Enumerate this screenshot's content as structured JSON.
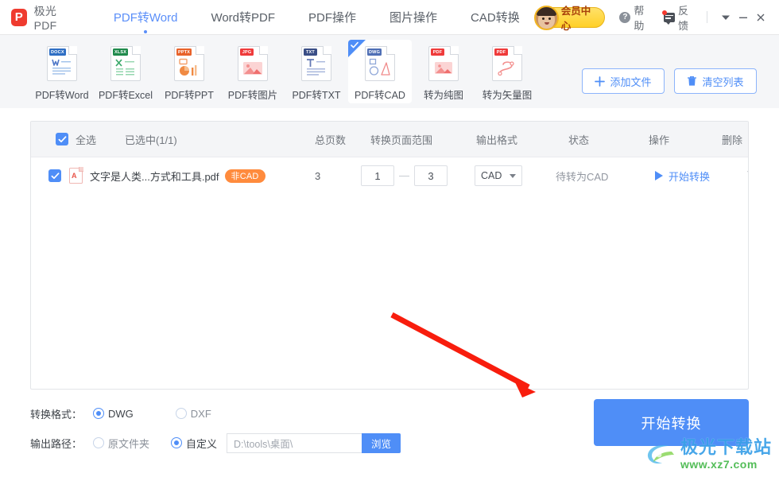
{
  "app": {
    "logo_letter": "P",
    "logo_text": "极光PDF"
  },
  "nav": {
    "items": [
      {
        "label": "PDF转Word",
        "active": true
      },
      {
        "label": "Word转PDF",
        "active": false
      },
      {
        "label": "PDF操作",
        "active": false
      },
      {
        "label": "图片操作",
        "active": false
      },
      {
        "label": "CAD转换",
        "active": false
      }
    ]
  },
  "titlebar": {
    "vip_label": "会员中心",
    "help_label": "帮助",
    "help_glyph": "?",
    "feedback_label": "反馈",
    "dropdown_icon": "chevron-down-icon",
    "minimize_icon": "minimize-icon",
    "close_icon": "close-icon"
  },
  "toolstrip": {
    "tools": [
      {
        "label": "PDF转Word",
        "badge": "DOCX",
        "badge_color": "#2f6fc4",
        "selected": false,
        "icon": "word-doc-icon"
      },
      {
        "label": "PDF转Excel",
        "badge": "XLSX",
        "badge_color": "#1f8a4c",
        "selected": false,
        "icon": "excel-doc-icon"
      },
      {
        "label": "PDF转PPT",
        "badge": "PPTX",
        "badge_color": "#e8622a",
        "selected": false,
        "icon": "ppt-doc-icon"
      },
      {
        "label": "PDF转图片",
        "badge": "JPG",
        "badge_color": "#ef3b3b",
        "selected": false,
        "icon": "image-doc-icon"
      },
      {
        "label": "PDF转TXT",
        "badge": "TXT",
        "badge_color": "#3a4e86",
        "selected": false,
        "icon": "txt-doc-icon"
      },
      {
        "label": "PDF转CAD",
        "badge": "DWG",
        "badge_color": "#4f6fb5",
        "selected": true,
        "icon": "cad-doc-icon"
      },
      {
        "label": "转为纯图",
        "badge": "PDF",
        "badge_color": "#ef3b3b",
        "selected": false,
        "icon": "raster-doc-icon"
      },
      {
        "label": "转为矢量图",
        "badge": "PDF",
        "badge_color": "#ef3b3b",
        "selected": false,
        "icon": "vector-doc-icon"
      }
    ],
    "add_file_label": "添加文件",
    "clear_list_label": "清空列表"
  },
  "table": {
    "headers": {
      "select_all": "全选",
      "selected_count": "已选中(1/1)",
      "total_pages": "总页数",
      "page_range": "转换页面范围",
      "output_format": "输出格式",
      "status": "状态",
      "operation": "操作",
      "delete": "删除"
    },
    "rows": [
      {
        "checked": true,
        "filename": "文字是人类...方式和工具.pdf",
        "tag": "非CAD",
        "total_pages": "3",
        "range_from": "1",
        "range_to": "3",
        "format": "CAD",
        "status": "待转为CAD",
        "operation": "开始转换",
        "delete_icon": "trash-icon"
      }
    ]
  },
  "settings": {
    "format_label": "转换格式：",
    "format_options": [
      {
        "label": "DWG",
        "selected": true
      },
      {
        "label": "DXF",
        "selected": false
      }
    ],
    "path_label": "输出路径：",
    "path_options": [
      {
        "label": "原文件夹",
        "selected": false
      },
      {
        "label": "自定义",
        "selected": true
      }
    ],
    "path_value": "D:\\tools\\桌面\\",
    "browse_label": "浏览"
  },
  "cta": {
    "label": "开始转换"
  },
  "watermark": {
    "cn": "极光下载站",
    "en": "www.xz7.com"
  },
  "colors": {
    "accent": "#4f8ef7",
    "brand_red": "#ef3b2f",
    "vip_gold": "#ffd027",
    "tag_orange": "#ff8b3d",
    "arrow_red": "#f81d0d"
  }
}
